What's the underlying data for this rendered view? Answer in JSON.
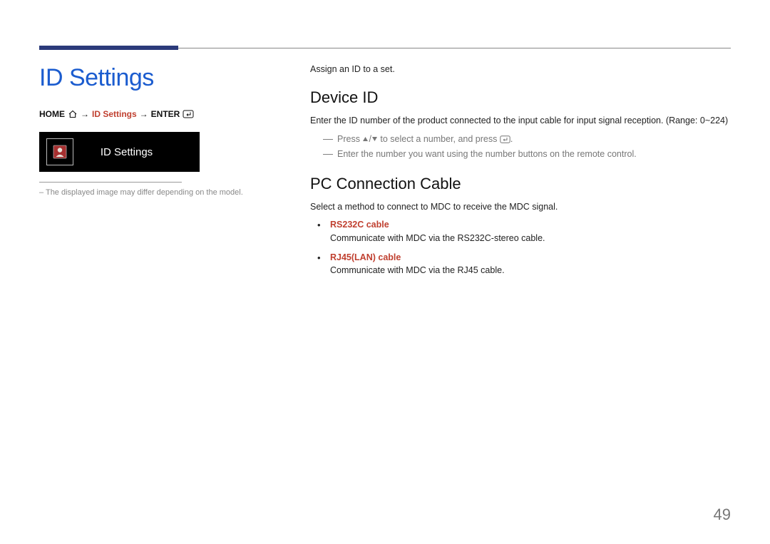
{
  "page": {
    "title": "ID Settings",
    "number": "49"
  },
  "breadcrumb": {
    "home": "HOME",
    "mid": "ID Settings",
    "enter": "ENTER"
  },
  "card": {
    "label": "ID Settings"
  },
  "footnote": "– The displayed image may differ depending on the model.",
  "main": {
    "intro": "Assign an ID to a set.",
    "section1": {
      "title": "Device ID",
      "body": "Enter the ID number of the product connected to the input cable for input signal reception. (Range: 0~224)",
      "dash1_pre": "Press ",
      "dash1_mid": "/",
      "dash1_post": " to select a number, and press ",
      "dash1_end": ".",
      "dash2": "Enter the number you want using the number buttons on the remote control."
    },
    "section2": {
      "title": "PC Connection Cable",
      "body": "Select a method to connect to MDC to receive the MDC signal.",
      "items": [
        {
          "head": "RS232C cable",
          "desc": "Communicate with MDC via the RS232C-stereo cable."
        },
        {
          "head": "RJ45(LAN) cable",
          "desc": "Communicate with MDC via the RJ45 cable."
        }
      ]
    }
  }
}
